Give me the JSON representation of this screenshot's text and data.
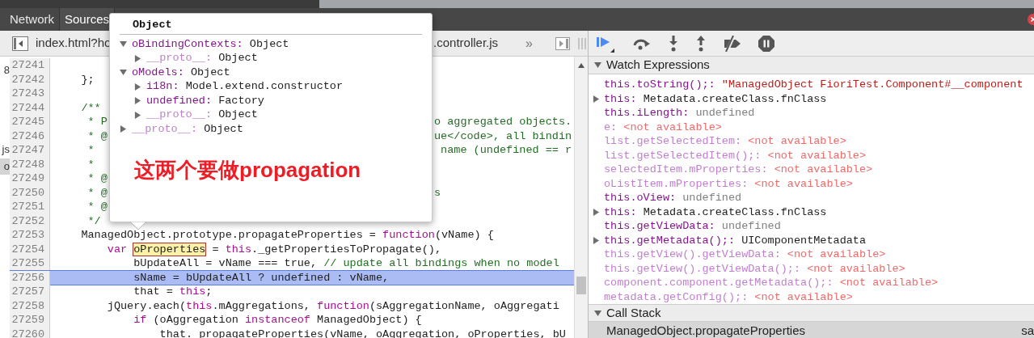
{
  "top_tabs": [
    {
      "label": "Network",
      "selected": false
    },
    {
      "label": "Sources",
      "selected": true
    }
  ],
  "file_tabs": [
    {
      "label": "index.html?ho"
    },
    {
      "label": ".controller.js"
    }
  ],
  "file_overflow": "»",
  "sidebar_fragments": [
    {
      "text": "8",
      "selected": false
    },
    {
      "text": "js",
      "selected": false
    },
    {
      "text": "o",
      "selected": true
    }
  ],
  "code_lines": [
    {
      "number": "27241",
      "selected": false
    },
    {
      "number": "27242",
      "selected": false,
      "segments": [
        {
          "text": "    };",
          "kind": "plain"
        }
      ]
    },
    {
      "number": "27243",
      "selected": false
    },
    {
      "number": "27244",
      "selected": false,
      "segments": [
        {
          "text": "    /**",
          "kind": "comment"
        }
      ]
    },
    {
      "number": "27245",
      "selected": false,
      "segments": [
        {
          "text": "     * P",
          "kind": "comment"
        }
      ],
      "right": "o aggregated objects."
    },
    {
      "number": "27246",
      "selected": false,
      "segments": [
        {
          "text": "     * @",
          "kind": "comment"
        }
      ],
      "right": "ue</code>, all bindin"
    },
    {
      "number": "27247",
      "selected": false,
      "segments": [
        {
          "text": "     *",
          "kind": "comment"
        }
      ],
      "right": " name (undefined == r"
    },
    {
      "number": "27248",
      "selected": false,
      "segments": [
        {
          "text": "     *",
          "kind": "comment"
        }
      ]
    },
    {
      "number": "27249",
      "selected": false,
      "segments": [
        {
          "text": "     * @",
          "kind": "comment"
        }
      ]
    },
    {
      "number": "27250",
      "selected": false,
      "segments": [
        {
          "text": "     * @",
          "kind": "comment"
        }
      ],
      "right": "s"
    },
    {
      "number": "27251",
      "selected": false,
      "segments": [
        {
          "text": "     * @",
          "kind": "comment"
        }
      ]
    },
    {
      "number": "27252",
      "selected": false,
      "segments": [
        {
          "text": "     */",
          "kind": "comment"
        }
      ]
    },
    {
      "number": "27253",
      "selected": false,
      "segments": [
        {
          "text": "    ManagedObject.prototype.propagateProperties = ",
          "kind": "plain"
        },
        {
          "text": "function",
          "kind": "keyword"
        },
        {
          "text": "(vName) {",
          "kind": "plain"
        }
      ]
    },
    {
      "number": "27254",
      "selected": false,
      "segments": [
        {
          "text": "        var ",
          "kind": "keyword"
        },
        {
          "text": "oProperties",
          "kind": "mark"
        },
        {
          "text": " = ",
          "kind": "plain"
        },
        {
          "text": "this",
          "kind": "keyword"
        },
        {
          "text": "._getPropertiesToPropagate(),",
          "kind": "plain"
        }
      ]
    },
    {
      "number": "27255",
      "selected": false,
      "segments": [
        {
          "text": "            bUpdateAll = vName === true, ",
          "kind": "plain"
        },
        {
          "text": "// update all bindings when no model",
          "kind": "comment"
        }
      ]
    },
    {
      "number": "27256",
      "selected": true,
      "segments": [
        {
          "text": "            sName = bUpdateAll ? undefined : vName,",
          "kind": "plain"
        }
      ]
    },
    {
      "number": "27257",
      "selected": false,
      "segments": [
        {
          "text": "            that = ",
          "kind": "plain"
        },
        {
          "text": "this",
          "kind": "keyword"
        },
        {
          "text": ";",
          "kind": "plain"
        }
      ]
    },
    {
      "number": "27258",
      "selected": false,
      "segments": [
        {
          "text": "        jQuery.each(",
          "kind": "plain"
        },
        {
          "text": "this",
          "kind": "keyword"
        },
        {
          "text": ".mAggregations, ",
          "kind": "plain"
        },
        {
          "text": "function",
          "kind": "keyword"
        },
        {
          "text": "(sAggregationName, oAggregati",
          "kind": "plain"
        }
      ]
    },
    {
      "number": "27259",
      "selected": false,
      "segments": [
        {
          "text": "            if",
          "kind": "keyword"
        },
        {
          "text": " (oAggregation ",
          "kind": "plain"
        },
        {
          "text": "instanceof",
          "kind": "keyword"
        },
        {
          "text": " ManagedObject) {",
          "kind": "plain"
        }
      ]
    },
    {
      "number": "27260",
      "selected": false,
      "segments": [
        {
          "text": "                that._propagateProperties(vName, oAggregation, oProperties, bU",
          "kind": "plain"
        }
      ]
    }
  ],
  "popover": {
    "title": "Object",
    "tree": [
      {
        "key": "oBindingContexts:",
        "value": "Object",
        "kind": "property",
        "expanded": true,
        "children": [
          {
            "key": "__proto__:",
            "value": "Object",
            "kind": "proto",
            "expanded": false
          }
        ]
      },
      {
        "key": "oModels:",
        "value": "Object",
        "kind": "property",
        "expanded": true,
        "children": [
          {
            "key": "i18n:",
            "value": "Model.extend.constructor",
            "kind": "property",
            "expanded": false
          },
          {
            "key": "undefined:",
            "value": "Factory",
            "kind": "property",
            "expanded": false
          },
          {
            "key": "__proto__:",
            "value": "Object",
            "kind": "proto",
            "expanded": false
          }
        ]
      },
      {
        "key": "__proto__:",
        "value": "Object",
        "kind": "proto",
        "expanded": false
      }
    ],
    "annotation": "这两个要做propagation"
  },
  "watch": {
    "title": "Watch Expressions",
    "expanded": true,
    "items": [
      {
        "name": "this.toString();:",
        "value": "\"ManagedObject FioriTest.Component#__component",
        "kind": "string",
        "expandable": false
      },
      {
        "name": "this:",
        "value": "Metadata.createClass.fnClass",
        "kind": "object",
        "expandable": true
      },
      {
        "name": "this.iLength:",
        "value": "undefined",
        "kind": "undefined",
        "expandable": false
      },
      {
        "name": "e:",
        "value": "<not available>",
        "kind": "unavailable",
        "expandable": false
      },
      {
        "name": "list.getSelectedItem:",
        "value": "<not available>",
        "kind": "unavailable",
        "expandable": false
      },
      {
        "name": "list.getSelectedItem();:",
        "value": "<not available>",
        "kind": "unavailable",
        "expandable": false
      },
      {
        "name": "selectedItem.mProperties:",
        "value": "<not available>",
        "kind": "unavailable",
        "expandable": false
      },
      {
        "name": "oListItem.mProperties:",
        "value": "<not available>",
        "kind": "unavailable",
        "expandable": false
      },
      {
        "name": "this.oView:",
        "value": "undefined",
        "kind": "undefined",
        "expandable": false
      },
      {
        "name": "this:",
        "value": "Metadata.createClass.fnClass",
        "kind": "object",
        "expandable": true
      },
      {
        "name": "this.getViewData:",
        "value": "undefined",
        "kind": "undefined",
        "expandable": false
      },
      {
        "name": "this.getMetadata();:",
        "value": "UIComponentMetadata",
        "kind": "object",
        "expandable": true
      },
      {
        "name": "this.getView().getViewData:",
        "value": "<not available>",
        "kind": "unavailable",
        "expandable": false
      },
      {
        "name": "this.getView().getViewData();:",
        "value": "<not available>",
        "kind": "unavailable",
        "expandable": false
      },
      {
        "name": "component.component.getMetadata();:",
        "value": "<not available>",
        "kind": "unavailable",
        "expandable": false
      },
      {
        "name": "metadata.getConfig();:",
        "value": "<not available>",
        "kind": "unavailable",
        "expandable": false
      }
    ]
  },
  "call_stack": {
    "title": "Call Stack",
    "expanded": true,
    "frames": [
      {
        "function": "ManagedObject.propagateProperties",
        "file": "sa",
        "selected": true
      }
    ]
  }
}
